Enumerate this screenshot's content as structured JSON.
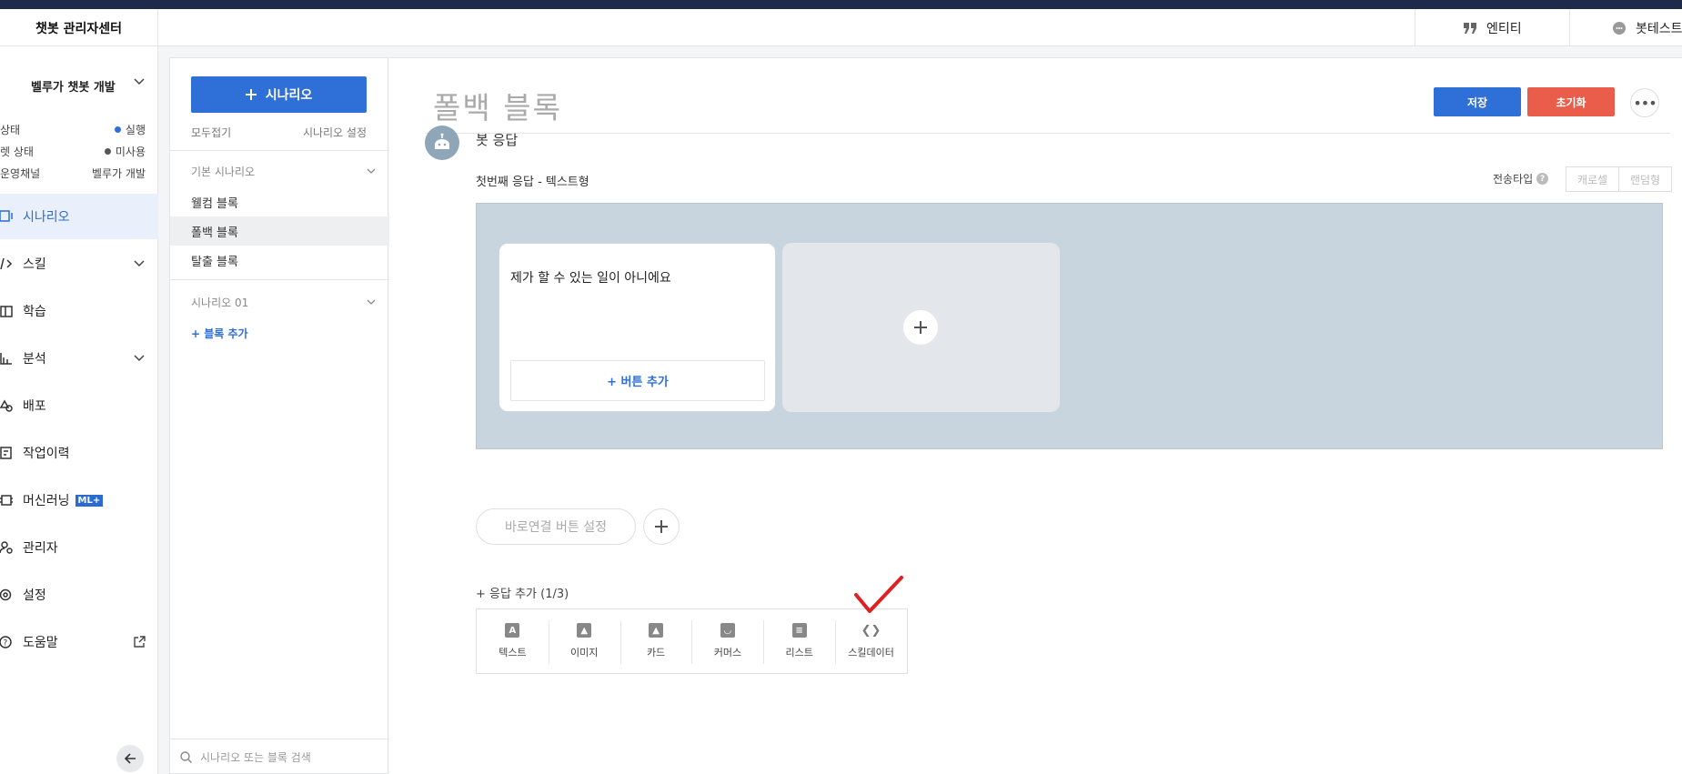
{
  "header": {
    "app_title": "챗봇 관리자센터",
    "tabs": [
      {
        "label": "엔티티",
        "icon": "quote-icon"
      },
      {
        "label": "봇테스트",
        "icon": "chat-bubble-icon"
      }
    ]
  },
  "sidebar": {
    "project_name": "벨루가 챗봇 개발",
    "status": [
      {
        "label": "상태",
        "value": "실행",
        "dot_color": "#2f6fd8"
      },
      {
        "label": "렛 상태",
        "value": "미사용",
        "dot_color": "#555555"
      },
      {
        "label": "운영채널",
        "value": "벨루가 개발",
        "dot_color": ""
      }
    ],
    "items": [
      {
        "label": "시나리오",
        "icon": "scenario-icon",
        "active": true
      },
      {
        "label": "스킬",
        "icon": "code-icon"
      },
      {
        "label": "학습",
        "icon": "book-icon"
      },
      {
        "label": "분석",
        "icon": "chart-icon"
      },
      {
        "label": "배포",
        "icon": "deploy-icon"
      },
      {
        "label": "작업이력",
        "icon": "history-icon"
      },
      {
        "label": "머신러닝",
        "icon": "chip-icon",
        "badge": "ML+"
      },
      {
        "label": "관리자",
        "icon": "admin-icon"
      },
      {
        "label": "설정",
        "icon": "gear-icon"
      },
      {
        "label": "도움말",
        "icon": "help-icon"
      }
    ]
  },
  "scenario_panel": {
    "add_button": "시나리오",
    "collapse_all": "모두접기",
    "scenario_settings": "시나리오 설정",
    "groups": [
      {
        "title": "기본 시나리오",
        "blocks": [
          "웰컴 블록",
          "폴백 블록",
          "탈출 블록"
        ]
      },
      {
        "title": "시나리오 01",
        "blocks": []
      }
    ],
    "add_block": "+ 블록 추가",
    "search_placeholder": "시나리오 또는 블록 검색"
  },
  "main": {
    "title": "폴백 블록",
    "save": "저장",
    "reset": "초기화",
    "bot_response": "봇 응답",
    "first_response": "첫번째 응답 - 텍스트형",
    "send_type": "전송타입",
    "send_modes": [
      "캐로셀",
      "랜덤형"
    ],
    "card_text": "제가 할 수 있는 일이 아니에요",
    "add_button": "+ 버튼 추가",
    "quick_reply": "바로연결 버튼 설정",
    "add_response": "+ 응답 추가 (1/3)",
    "response_types": [
      {
        "label": "텍스트",
        "icon": "text-icon",
        "glyph": "A"
      },
      {
        "label": "이미지",
        "icon": "image-icon",
        "glyph": "▲"
      },
      {
        "label": "카드",
        "icon": "card-icon",
        "glyph": "▲"
      },
      {
        "label": "커머스",
        "icon": "commerce-icon",
        "glyph": "◡"
      },
      {
        "label": "리스트",
        "icon": "list-icon",
        "glyph": "≡"
      },
      {
        "label": "스킬데이터",
        "icon": "code-icon",
        "glyph": "❮❯"
      }
    ],
    "accent_color": "#2f6fd8",
    "reset_color": "#ea5d4a",
    "annotation_color": "#e02020"
  }
}
